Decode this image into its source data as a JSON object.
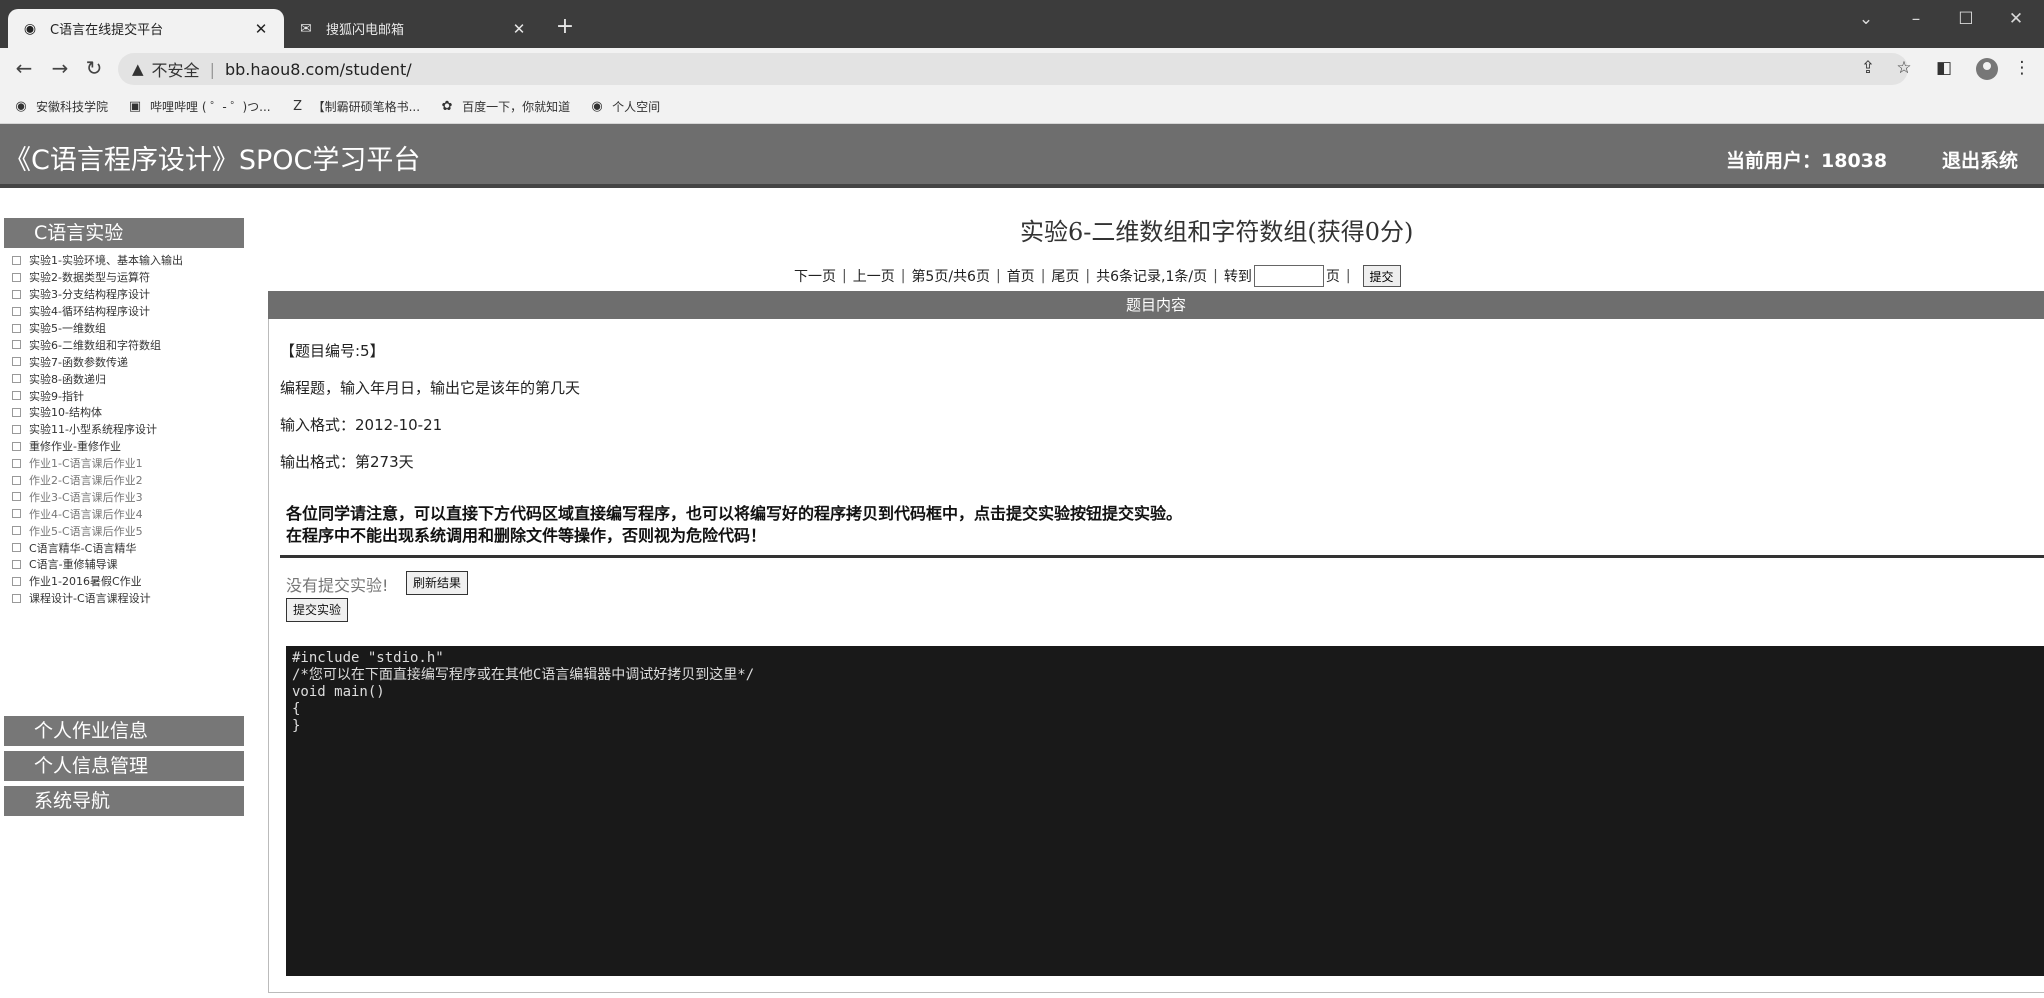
{
  "browser": {
    "tabs": [
      {
        "title": "C语言在线提交平台",
        "active": true
      },
      {
        "title": "搜狐闪电邮箱",
        "active": false
      }
    ],
    "address": {
      "security_label": "不安全",
      "url": "bb.haou8.com/student/"
    },
    "bookmarks": [
      "安徽科技学院",
      "哔哩哔哩 ( ゜- ゜)つ...",
      "【制霸研硕笔格书...",
      "百度一下，你就知道",
      "个人空间"
    ]
  },
  "header": {
    "site_title": "《C语言程序设计》SPOC学习平台",
    "current_user": "当前用户：18038",
    "logout": "退出系统"
  },
  "sidebar": {
    "section_title": "C语言实验",
    "items": [
      "实验1-实验环境、基本输入输出",
      "实验2-数据类型与运算符",
      "实验3-分支结构程序设计",
      "实验4-循环结构程序设计",
      "实验5-一维数组",
      "实验6-二维数组和字符数组",
      "实验7-函数参数传递",
      "实验8-函数递归",
      "实验9-指针",
      "实验10-结构体",
      "实验11-小型系统程序设计",
      "重修作业-重修作业",
      "作业1-C语言课后作业1",
      "作业2-C语言课后作业2",
      "作业3-C语言课后作业3",
      "作业4-C语言课后作业4",
      "作业5-C语言课后作业5",
      "C语言精华-C语言精华",
      "C语言-重修辅导课",
      "作业1-2016暑假C作业",
      "课程设计-C语言课程设计"
    ],
    "groups": [
      "个人作业信息",
      "个人信息管理",
      "系统导航"
    ]
  },
  "main": {
    "title": "实验6-二维数组和字符数组(获得0分)",
    "pager": {
      "next": "下一页",
      "prev": "上一页",
      "page_info": "第5页/共6页",
      "first": "首页",
      "last": "尾页",
      "records": "共6条记录,1条/页",
      "goto": "转到",
      "page_unit": "页",
      "submit": "提交"
    },
    "content_header": "题目内容",
    "question_no": "【题目编号:5】",
    "question_desc": "编程题，输入年月日，输出它是该年的第几天",
    "input_format": "输入格式：2012-10-21",
    "output_format": "输出格式：第273天",
    "notice_1": "各位同学请注意，可以直接下方代码区域直接编写程序，也可以将编写好的程序拷贝到代码框中，点击提交实验按钮提交实验。",
    "notice_2": "在程序中不能出现系统调用和删除文件等操作，否则视为危险代码！",
    "no_submission": "没有提交实验!",
    "refresh_button": "刷新结果",
    "submit_button": "提交实验",
    "code_lines": [
      "#include \"stdio.h\"",
      "/*您可以在下面直接编写程序或在其他C语言编辑器中调试好拷贝到这里*/",
      "void main()",
      "{",
      "}"
    ]
  }
}
